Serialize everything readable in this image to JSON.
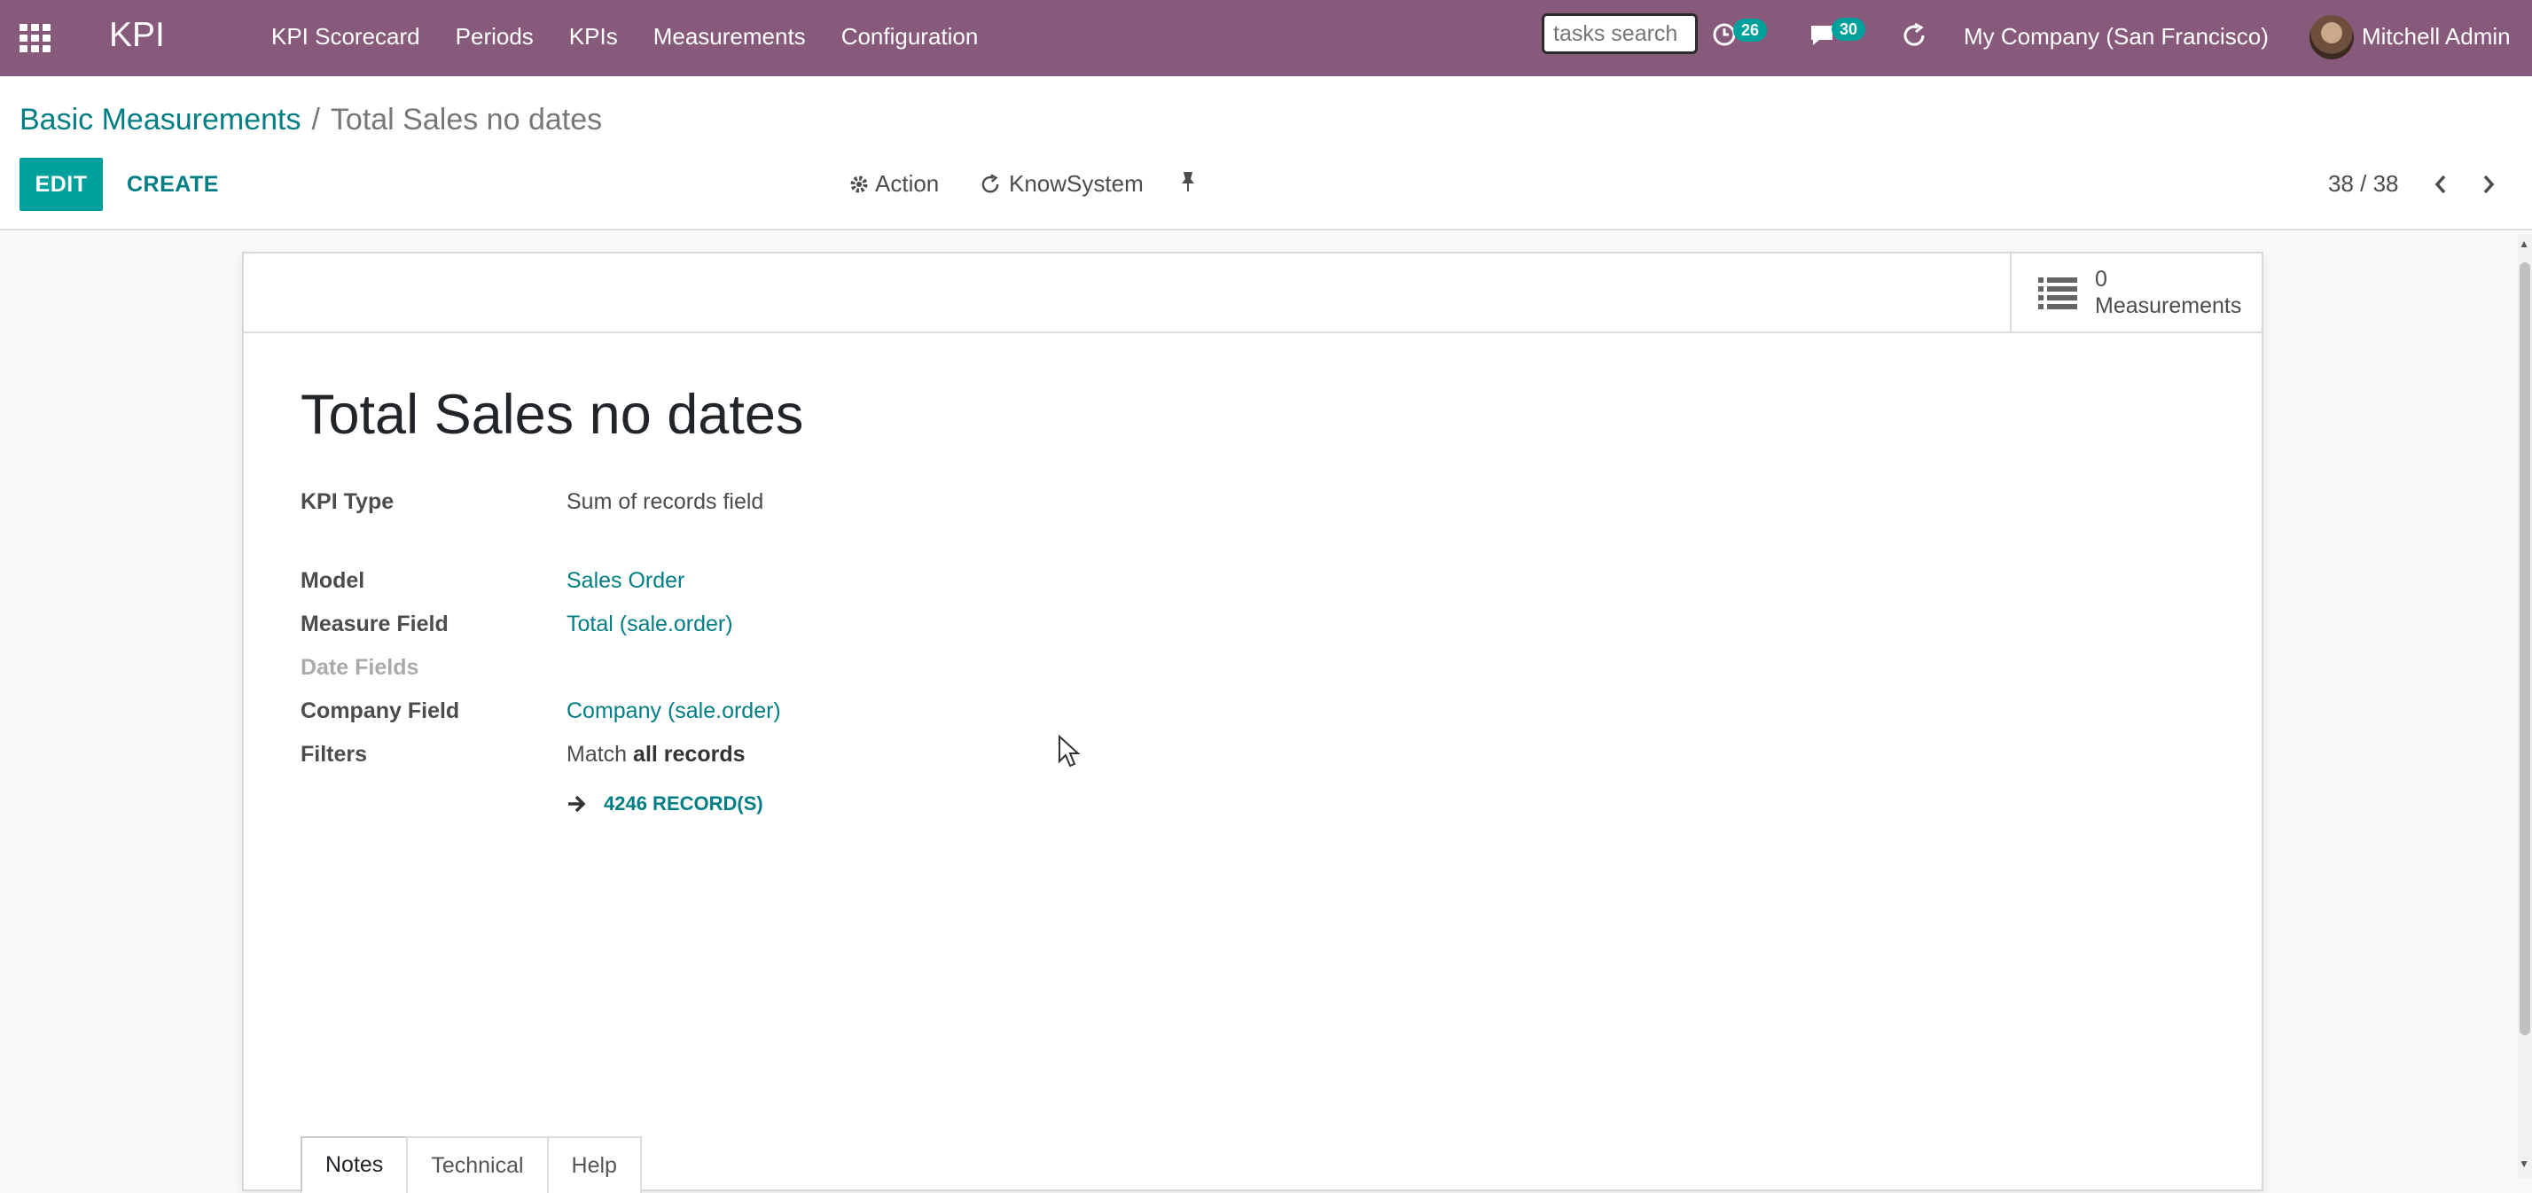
{
  "navbar": {
    "brand": "KPI",
    "menu": [
      "KPI Scorecard",
      "Periods",
      "KPIs",
      "Measurements",
      "Configuration"
    ],
    "search_placeholder": "tasks search",
    "activity_count": "26",
    "messages_count": "30",
    "company": "My Company (San Francisco)",
    "user": "Mitchell Admin",
    "colors": {
      "bar": "#875a7b",
      "badge": "#00a09d"
    }
  },
  "breadcrumb": {
    "parent": "Basic Measurements",
    "separator": "/",
    "current": "Total Sales no dates"
  },
  "toolbar": {
    "edit_label": "EDIT",
    "create_label": "CREATE",
    "action_label": "Action",
    "knowsystem_label": "KnowSystem"
  },
  "pager": {
    "value": "38 / 38"
  },
  "stat_button": {
    "value": "0",
    "label": "Measurements"
  },
  "form": {
    "title": "Total Sales no dates",
    "fields": {
      "kpi_type": {
        "label": "KPI Type",
        "value": "Sum of records field"
      },
      "model": {
        "label": "Model",
        "value": "Sales Order"
      },
      "measure_field": {
        "label": "Measure Field",
        "value": "Total (sale.order)"
      },
      "date_fields": {
        "label": "Date Fields",
        "value": ""
      },
      "company_field": {
        "label": "Company Field",
        "value": "Company (sale.order)"
      },
      "filters": {
        "label": "Filters",
        "value_prefix": "Match",
        "value_bold": "all records"
      }
    },
    "records_link": "4246 RECORD(S)",
    "tabs": [
      "Notes",
      "Technical",
      "Help"
    ],
    "active_tab": "Notes"
  }
}
